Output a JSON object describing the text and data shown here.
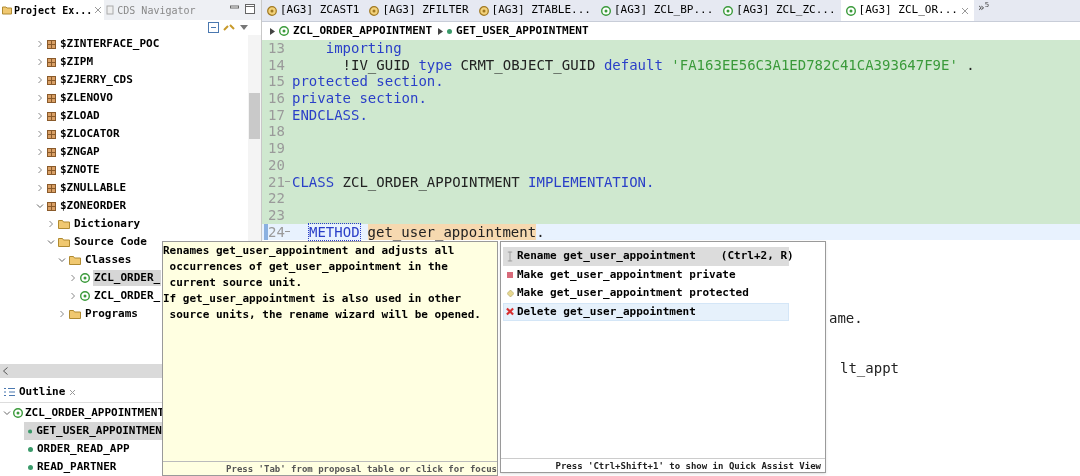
{
  "explorer_tabs": [
    {
      "label": "Project Ex...",
      "selected": true
    },
    {
      "label": "CDS Navigator",
      "selected": false
    }
  ],
  "project_tree": [
    {
      "label": "$ZINTERFACE_POC",
      "kind": "package",
      "expanded": false
    },
    {
      "label": "$ZIPM",
      "kind": "package",
      "expanded": false
    },
    {
      "label": "$ZJERRY_CDS",
      "kind": "package",
      "expanded": false
    },
    {
      "label": "$ZLENOVO",
      "kind": "package",
      "expanded": false
    },
    {
      "label": "$ZLOAD",
      "kind": "package",
      "expanded": false
    },
    {
      "label": "$ZLOCATOR",
      "kind": "package",
      "expanded": false
    },
    {
      "label": "$ZNGAP",
      "kind": "package",
      "expanded": false
    },
    {
      "label": "$ZNOTE",
      "kind": "package",
      "expanded": false
    },
    {
      "label": "$ZNULLABLE",
      "kind": "package",
      "expanded": false
    },
    {
      "label": "$ZONEORDER",
      "kind": "package",
      "expanded": true,
      "children": [
        {
          "label": "Dictionary",
          "kind": "folder",
          "expanded": false
        },
        {
          "label": "Source Code",
          "kind": "folder",
          "expanded": true,
          "children": [
            {
              "label": "Classes",
              "kind": "folder",
              "expanded": true,
              "children": [
                {
                  "label": "ZCL_ORDER_",
                  "kind": "class",
                  "expanded": false,
                  "selected": true
                },
                {
                  "label": "ZCL_ORDER_",
                  "kind": "class",
                  "expanded": false,
                  "selected": false
                }
              ]
            },
            {
              "label": "Programs",
              "kind": "folder",
              "expanded": false
            }
          ]
        }
      ]
    }
  ],
  "outline": {
    "title": "Outline",
    "root": {
      "label": "ZCL_ORDER_APPOINTMENT",
      "expanded": true,
      "children": [
        {
          "label": "GET_USER_APPOINTMEN",
          "selected": true
        },
        {
          "label": "ORDER_READ_APP",
          "selected": false
        },
        {
          "label": "READ_PARTNER",
          "selected": false
        }
      ]
    }
  },
  "editor_tabs": [
    {
      "label": "[AG3] ZCAST1",
      "kind": "interface",
      "selected": false
    },
    {
      "label": "[AG3] ZFILTER",
      "kind": "interface",
      "selected": false
    },
    {
      "label": "[AG3] ZTABLE...",
      "kind": "interface",
      "selected": false
    },
    {
      "label": "[AG3] ZCL_BP...",
      "kind": "class",
      "selected": false
    },
    {
      "label": "[AG3] ZCL_ZC...",
      "kind": "class",
      "selected": false
    },
    {
      "label": "[AG3] ZCL_OR...",
      "kind": "class",
      "selected": true
    }
  ],
  "tab_overflow": {
    "symbol": "»",
    "count": "5"
  },
  "breadcrumb": [
    "ZCL_ORDER_APPOINTMENT",
    "GET_USER_APPOINTMENT"
  ],
  "code_lines": [
    {
      "number": "13",
      "color": "#cfe8cf",
      "fold": false,
      "tokens": [
        {
          "kind": "keyword",
          "text": "    importing"
        }
      ]
    },
    {
      "number": "14",
      "color": "#cfe8cf",
      "fold": false,
      "tokens": [
        {
          "kind": "plain",
          "text": "      !IV_GUID "
        },
        {
          "kind": "keyword",
          "text": "type"
        },
        {
          "kind": "plain",
          "text": " CRMT_OBJECT_GUID "
        },
        {
          "kind": "keyword",
          "text": "default"
        },
        {
          "kind": "string",
          "text": " 'FA163EE56C3A1ED782C41CA393647F9E'"
        },
        {
          "kind": "plain",
          "text": " ."
        }
      ]
    },
    {
      "number": "15",
      "color": "#cfe8cf",
      "fold": false,
      "tokens": [
        {
          "kind": "keyword",
          "text": "protected section."
        }
      ]
    },
    {
      "number": "16",
      "color": "#cfe8cf",
      "fold": false,
      "tokens": [
        {
          "kind": "keyword",
          "text": "private section."
        }
      ]
    },
    {
      "number": "17",
      "color": "#cfe8cf",
      "fold": false,
      "tokens": [
        {
          "kind": "keyword",
          "text": "ENDCLASS."
        }
      ]
    },
    {
      "number": "18",
      "color": "#cfe8cf",
      "fold": false
    },
    {
      "number": "19",
      "color": "#cfe8cf",
      "fold": false
    },
    {
      "number": "20",
      "color": "#cfe8cf",
      "fold": false
    },
    {
      "number": "21",
      "color": "#cfe8cf",
      "fold": true,
      "tokens": [
        {
          "kind": "keyword",
          "text": "CLASS"
        },
        {
          "kind": "plain",
          "text": " ZCL_ORDER_APPOINTMENT "
        },
        {
          "kind": "keyword",
          "text": "IMPLEMENTATION."
        }
      ]
    },
    {
      "number": "22",
      "color": "#cfe8cf",
      "fold": false
    },
    {
      "number": "23",
      "color": "#cfe8cf",
      "fold": false
    },
    {
      "number": "24",
      "color": "#e8f2fe",
      "fold": true,
      "tokens": [
        {
          "kind": "keyword_boxed",
          "text": "METHOD"
        },
        {
          "kind": "occurrence",
          "text": "get_user_appointment"
        },
        {
          "kind": "plain",
          "text": "."
        }
      ]
    }
  ],
  "code_fragments": [
    {
      "tokens": [
        {
          "kind": "plain",
          "text": "ame."
        }
      ]
    },
    {
      "tokens": [
        {
          "kind": "plain",
          "text": "lt_appt"
        }
      ]
    }
  ],
  "tooltip": {
    "text": "Renames get_user_appointment and adjusts all\n occurrences of get_user_appointment in the\n current source unit.\nIf get_user_appointment is also used in other\n source units, the rename wizard will be opened.",
    "footer": "Press 'Tab' from proposal table or click for focus"
  },
  "quick_assist": {
    "items": [
      {
        "label": "Rename get_user_appointment",
        "shortcut": "(Ctrl+2, R)",
        "kind": "rename",
        "selected": true,
        "hovered": false
      },
      {
        "label": "Make get_user_appointment private",
        "kind": "private",
        "selected": false,
        "hovered": false
      },
      {
        "label": "Make get_user_appointment protected",
        "kind": "protected",
        "selected": false,
        "hovered": false
      },
      {
        "label": "Delete get_user_appointment",
        "kind": "delete",
        "selected": false,
        "hovered": true
      }
    ],
    "footer": "Press 'Ctrl+Shift+1' to show in Quick Assist View"
  }
}
